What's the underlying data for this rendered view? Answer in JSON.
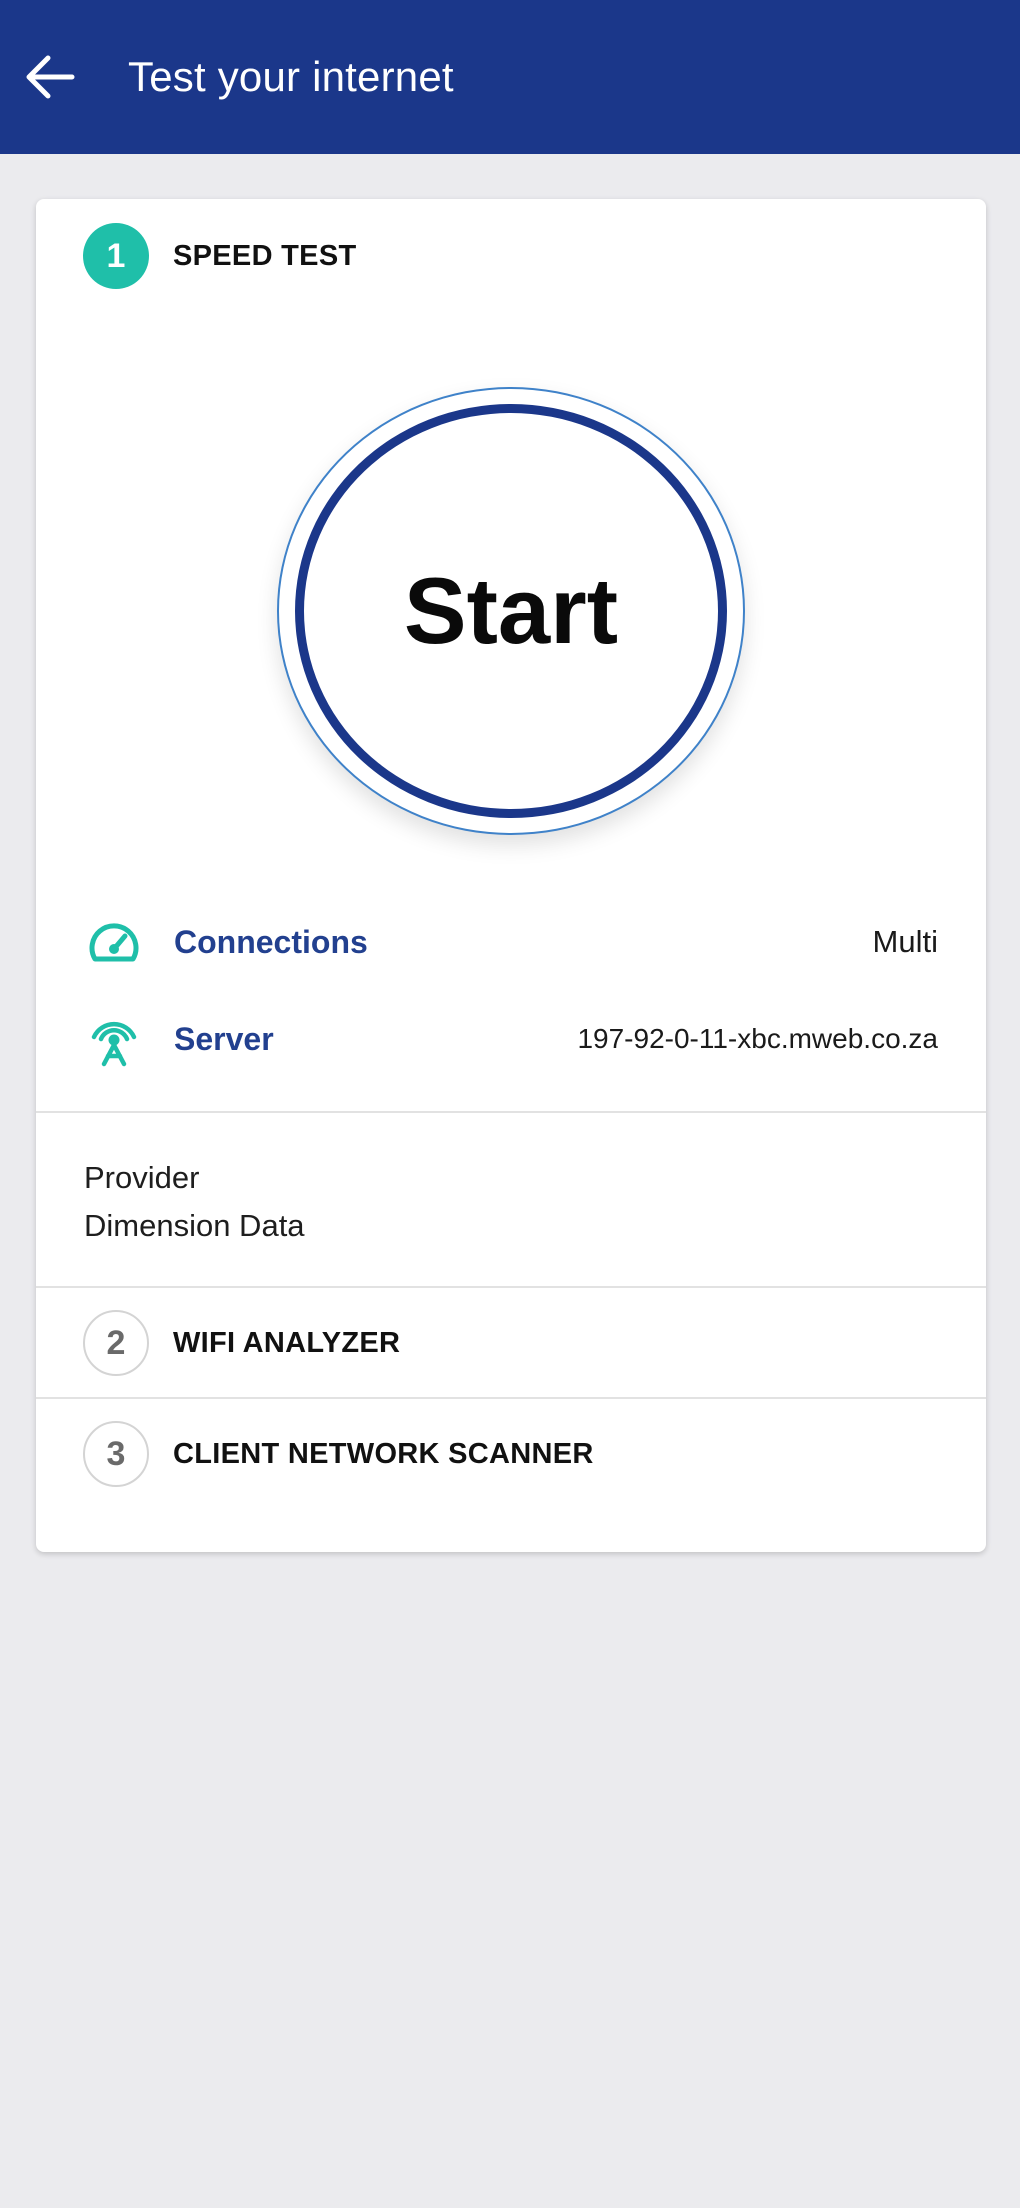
{
  "appbar": {
    "title": "Test your internet",
    "back_icon": "arrow-left-icon",
    "background": "#1b378a"
  },
  "steps": [
    {
      "number": "1",
      "label": "SPEED TEST",
      "active": true
    },
    {
      "number": "2",
      "label": "WIFI ANALYZER",
      "active": false
    },
    {
      "number": "3",
      "label": "CLIENT NETWORK SCANNER",
      "active": false
    }
  ],
  "speed_test": {
    "start_label": "Start",
    "connections": {
      "icon": "speedometer-icon",
      "label": "Connections",
      "value": "Multi"
    },
    "server": {
      "icon": "antenna-icon",
      "label": "Server",
      "value": "197-92-0-11-xbc.mweb.co.za"
    },
    "provider": {
      "label": "Provider",
      "value": "Dimension Data"
    }
  },
  "colors": {
    "accent_teal": "#1fbfa9",
    "brand_blue": "#1b378a",
    "label_blue": "#22408f",
    "ring_blue": "#3f82c9"
  }
}
